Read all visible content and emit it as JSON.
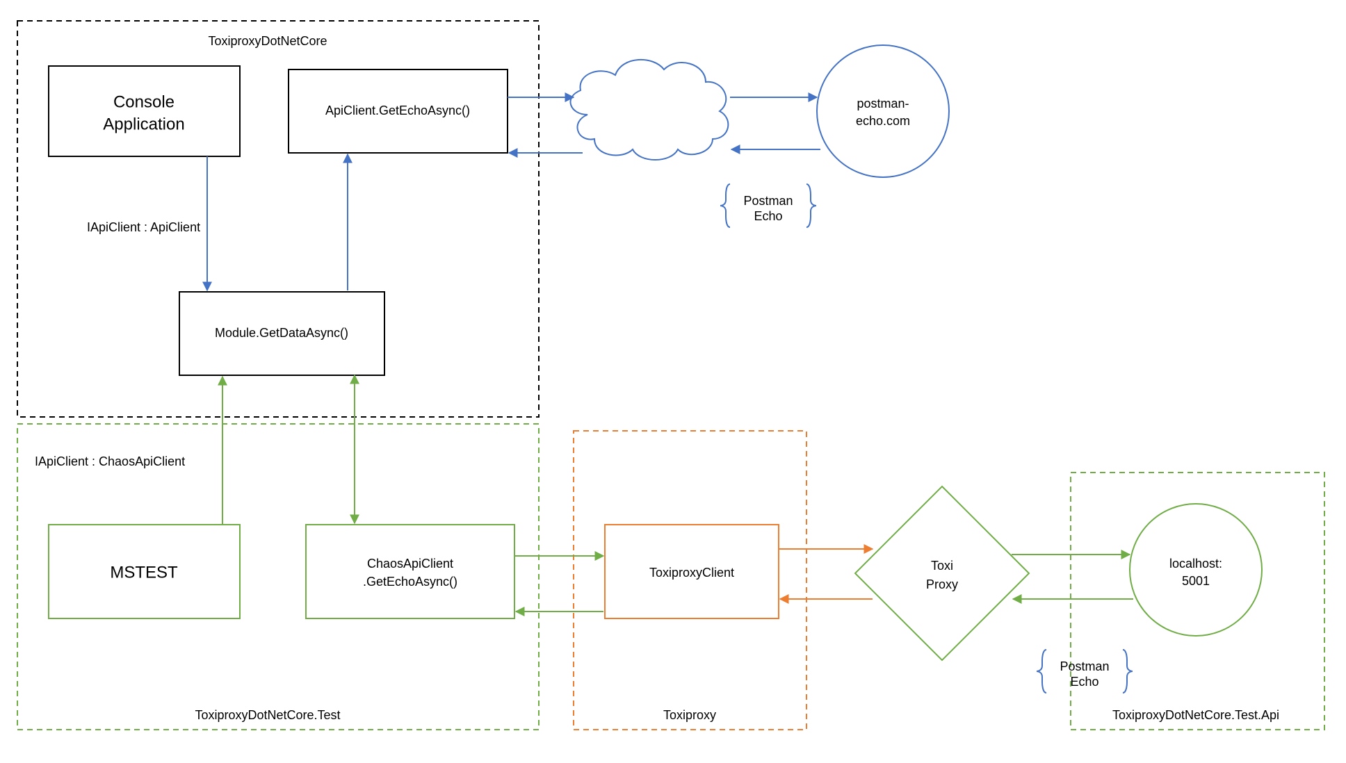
{
  "containers": {
    "core": {
      "label": "ToxiproxyDotNetCore"
    },
    "test": {
      "label": "ToxiproxyDotNetCore.Test"
    },
    "toxiproxy": {
      "label": "Toxiproxy"
    },
    "testapi": {
      "label": "ToxiproxyDotNetCore.Test.Api"
    }
  },
  "boxes": {
    "console": {
      "line1": "Console",
      "line2": "Application"
    },
    "apiclient": {
      "label": "ApiClient.GetEchoAsync()"
    },
    "module": {
      "label": "Module.GetDataAsync()"
    },
    "mstest": {
      "label": "MSTEST"
    },
    "chaosclient": {
      "line1": "ChaosApiClient",
      "line2": ".GetEchoAsync()"
    },
    "toxiproxyclient": {
      "label": "ToxiproxyClient"
    },
    "toxiproxydiamond": {
      "line1": "Toxi",
      "line2": "Proxy"
    },
    "postmanecho": {
      "line1": "postman-",
      "line2": "echo.com"
    },
    "localhost": {
      "line1": "localhost:",
      "line2": "5001"
    }
  },
  "labels": {
    "iapiclient": "IApiClient : ApiClient",
    "ichaosclient": "IApiClient : ChaosApiClient",
    "postmanecho_note": {
      "line1": "Postman",
      "line2": "Echo"
    }
  },
  "colors": {
    "black": "#000000",
    "blue": "#4472C4",
    "green": "#70AD47",
    "orange": "#ED7D31"
  }
}
